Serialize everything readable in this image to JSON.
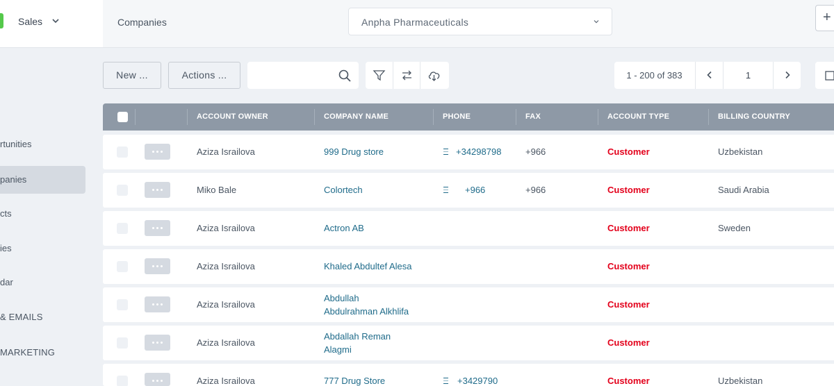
{
  "sidebar": {
    "app_label": "Sales",
    "items": [
      {
        "label": "rtunities"
      },
      {
        "label": "panies"
      },
      {
        "label": "cts"
      },
      {
        "label": "ies"
      },
      {
        "label": "dar"
      },
      {
        "label": "& EMAILS"
      },
      {
        "label": "MARKETING"
      }
    ]
  },
  "topbar": {
    "breadcrumb": "Companies",
    "company_select": "Anpha Pharmaceuticals",
    "plus_label": "+"
  },
  "toolbar": {
    "new_label": "New ...",
    "actions_label": "Actions ...",
    "search_value": "",
    "pager_range": "1 - 200 of 383",
    "page_number": "1"
  },
  "table": {
    "columns": [
      "ACCOUNT OWNER",
      "COMPANY NAME",
      "PHONE",
      "FAX",
      "ACCOUNT TYPE",
      "BILLING COUNTRY"
    ],
    "rows": [
      {
        "owner": "Aziza Israilova",
        "company": [
          "999 Drug store"
        ],
        "phone": "+34298798",
        "fax": "+966",
        "type": "Customer",
        "country": "Uzbekistan"
      },
      {
        "owner": "Miko Bale",
        "company": [
          "Colortech"
        ],
        "phone": "+966",
        "fax": "+966",
        "type": "Customer",
        "country": "Saudi Arabia"
      },
      {
        "owner": "Aziza Israilova",
        "company": [
          "Actron AB"
        ],
        "phone": "",
        "fax": "",
        "type": "Customer",
        "country": "Sweden"
      },
      {
        "owner": "Aziza Israilova",
        "company": [
          "Khaled Abdultef Alesa"
        ],
        "phone": "",
        "fax": "",
        "type": "Customer",
        "country": ""
      },
      {
        "owner": "Aziza Israilova",
        "company": [
          "Abdullah",
          "Abdulrahman Alkhlifa"
        ],
        "phone": "",
        "fax": "",
        "type": "Customer",
        "country": ""
      },
      {
        "owner": "Aziza Israilova",
        "company": [
          "Abdallah Reman",
          "Alagmi"
        ],
        "phone": "",
        "fax": "",
        "type": "Customer",
        "country": ""
      },
      {
        "owner": "Aziza Israilova",
        "company": [
          "777 Drug Store"
        ],
        "phone": "+3429790",
        "fax": "",
        "type": "Customer",
        "country": "Uzbekistan"
      }
    ]
  },
  "colors": {
    "accent_green": "#55c94b",
    "link": "#1f6b8a",
    "customer_red": "#e3001b",
    "header_bg": "#8e99a6"
  },
  "icons": {
    "brand": "app-dropdown-chevron",
    "search": "search-icon",
    "filter": "filter-icon",
    "swap": "swap-icon",
    "download": "cloud-download-icon",
    "prev": "chevron-left-icon",
    "next": "chevron-right-icon",
    "phone": "phone-icon",
    "more": "more-icon"
  }
}
